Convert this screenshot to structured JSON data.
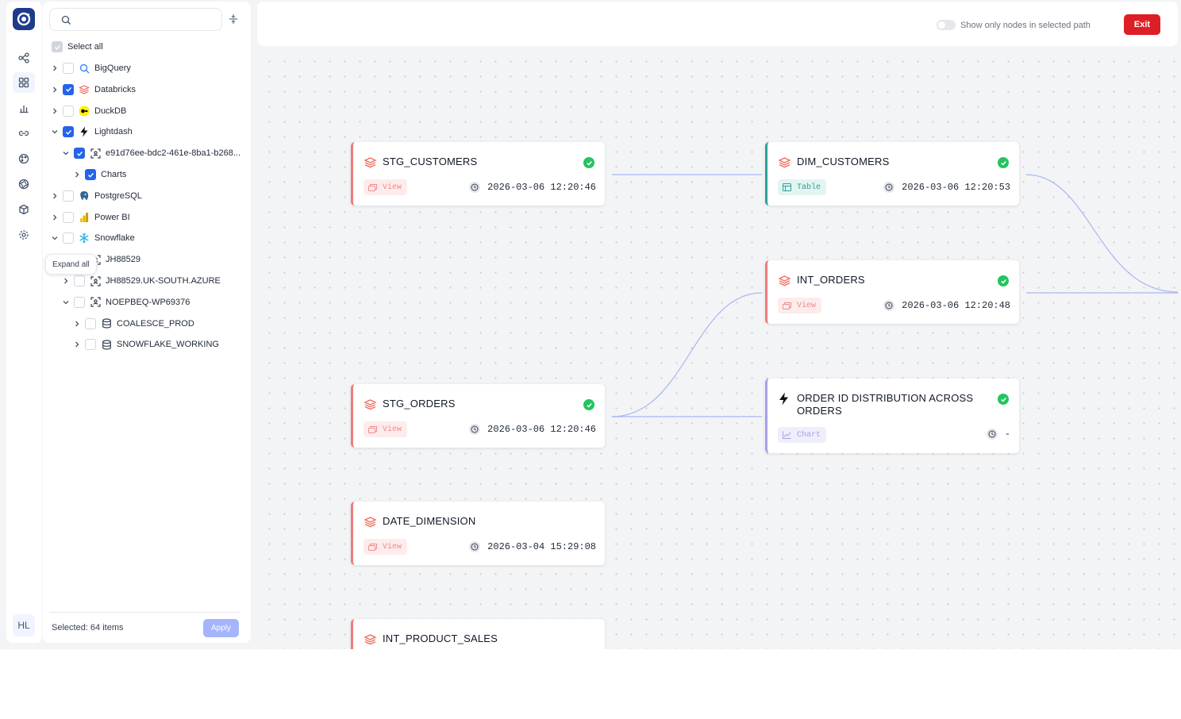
{
  "rail": {
    "avatar_initials": "HL",
    "items": [
      {
        "icon": "lineage-icon"
      },
      {
        "icon": "grid-icon",
        "active": true
      },
      {
        "icon": "bar-chart-icon"
      },
      {
        "icon": "link-icon"
      },
      {
        "icon": "palette-icon"
      },
      {
        "icon": "aperture-icon"
      },
      {
        "icon": "cube-icon"
      },
      {
        "icon": "gear-icon"
      }
    ]
  },
  "filter_panel": {
    "search_placeholder": "",
    "tooltip": "Expand all",
    "select_all_label": "Select all",
    "tree": [
      {
        "label": "BigQuery",
        "level": 0,
        "expanded": false,
        "checked": false,
        "icon": "bigquery-icon"
      },
      {
        "label": "Databricks",
        "level": 0,
        "expanded": false,
        "checked": true,
        "icon": "databricks-icon"
      },
      {
        "label": "DuckDB",
        "level": 0,
        "expanded": false,
        "checked": false,
        "icon": "duckdb-icon"
      },
      {
        "label": "Lightdash",
        "level": 0,
        "expanded": true,
        "checked": true,
        "icon": "lightdash-icon"
      },
      {
        "label": "e91d76ee-bdc2-461e-8ba1-b268...",
        "level": 1,
        "expanded": true,
        "checked": true,
        "icon": "scan-icon"
      },
      {
        "label": "Charts",
        "level": 2,
        "expanded": false,
        "checked": true,
        "icon": ""
      },
      {
        "label": "PostgreSQL",
        "level": 0,
        "expanded": false,
        "checked": false,
        "icon": "postgresql-icon"
      },
      {
        "label": "Power BI",
        "level": 0,
        "expanded": false,
        "checked": false,
        "icon": "powerbi-icon"
      },
      {
        "label": "Snowflake",
        "level": 0,
        "expanded": true,
        "checked": false,
        "icon": "snowflake-icon"
      },
      {
        "label": "JH88529",
        "level": 1,
        "expanded": false,
        "checked": false,
        "icon": "scan-icon"
      },
      {
        "label": "JH88529.UK-SOUTH.AZURE",
        "level": 1,
        "expanded": false,
        "checked": false,
        "icon": "scan-icon"
      },
      {
        "label": "NOEPBEQ-WP69376",
        "level": 1,
        "expanded": true,
        "checked": false,
        "icon": "scan-icon"
      },
      {
        "label": "COALESCE_PROD",
        "level": 2,
        "expanded": false,
        "checked": false,
        "icon": "database-icon"
      },
      {
        "label": "SNOWFLAKE_WORKING",
        "level": 2,
        "expanded": false,
        "checked": false,
        "icon": "database-icon"
      }
    ],
    "selected_text": "Selected: 64 items",
    "apply_label": "Apply"
  },
  "topbar": {
    "toggle_label": "Show only nodes in selected path",
    "toggle_on": false,
    "exit_label": "Exit"
  },
  "nodes": [
    {
      "id": "stg_customers",
      "title": "STG_CUSTOMERS",
      "type": "View",
      "timestamp": "2026-03-06 12:20:46",
      "status": "success",
      "accent": "#ef7b7b"
    },
    {
      "id": "dim_customers",
      "title": "DIM_CUSTOMERS",
      "type": "Table",
      "timestamp": "2026-03-06 12:20:53",
      "status": "success",
      "accent": "#2aa198"
    },
    {
      "id": "int_orders",
      "title": "INT_ORDERS",
      "type": "View",
      "timestamp": "2026-03-06 12:20:48",
      "status": "success",
      "accent": "#ef7b7b"
    },
    {
      "id": "stg_orders",
      "title": "STG_ORDERS",
      "type": "View",
      "timestamp": "2026-03-06 12:20:46",
      "status": "success",
      "accent": "#ef7b7b"
    },
    {
      "id": "order_chart",
      "title": "ORDER ID DISTRIBUTION ACROSS ORDERS",
      "type": "Chart",
      "timestamp": "-",
      "status": "success",
      "accent": "#a5a0e8"
    },
    {
      "id": "date_dimension",
      "title": "DATE_DIMENSION",
      "type": "View",
      "timestamp": "2026-03-04 15:29:08",
      "status": "",
      "accent": "#ef7b7b"
    },
    {
      "id": "int_product_sales",
      "title": "INT_PRODUCT_SALES",
      "type": "",
      "timestamp": "",
      "status": "",
      "accent": "#ef7b7b"
    }
  ],
  "colors": {
    "accent": "#2563eb",
    "exit": "#dc1f26",
    "edge": "#a5b8f3",
    "success": "#22c55e"
  }
}
